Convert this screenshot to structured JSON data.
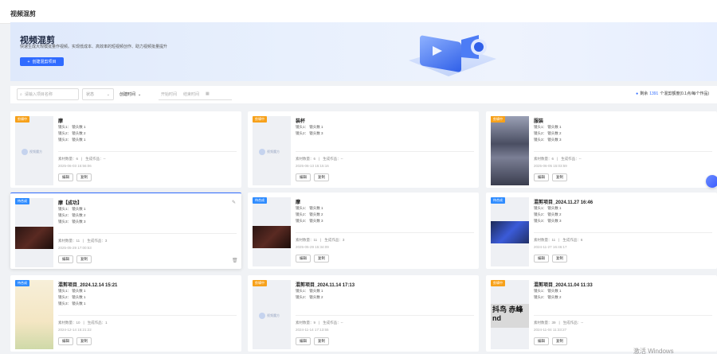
{
  "page": {
    "title": "视频混剪"
  },
  "banner": {
    "title": "视频混剪",
    "subtitle": "快速生成大规模批量作视频。实现低成本、高效率的短视频创作、助力视频批量提升",
    "create_button": "创建混剪项目"
  },
  "filters": {
    "search_placeholder": "请输入项目名称",
    "status_placeholder": "状态",
    "sort_label": "创建时间",
    "start_placeholder": "开始时间",
    "end_placeholder": "结束时间",
    "quota_prefix": "剩余",
    "quota_value": "1391",
    "quota_suffix": "个混剪额度(0.1点/每个作品)"
  },
  "cards": [
    {
      "badge": "剪辑中",
      "badge_color": "orange",
      "title": "摩",
      "lines": [
        "镜头1：  镜头数 1",
        "镜头2：  镜头数 2",
        "镜头3：  镜头数 1"
      ],
      "materials": "素材数量：6",
      "works": "生成作品：--",
      "date": "2025-06-03 15:56:06",
      "edit": "编辑",
      "copy": "复制",
      "thumb": "placeholder"
    },
    {
      "badge": "剪辑中",
      "badge_color": "orange",
      "title": "装杯",
      "lines": [
        "镜头1：  镜头数 1",
        "镜头2：  镜头数 3"
      ],
      "materials": "素材数量：6",
      "works": "生成作品：--",
      "date": "2025-06-13 15:15:16",
      "edit": "编辑",
      "copy": "复制",
      "thumb": "placeholder"
    },
    {
      "badge": "剪辑中",
      "badge_color": "orange",
      "title": "服装",
      "lines": [
        "镜头1：  镜头数 1",
        "镜头2：  镜头数 2",
        "镜头3：  镜头数 3"
      ],
      "materials": "素材数量：6",
      "works": "生成作品：--",
      "date": "2025-06-05 15:03:59",
      "edit": "编辑",
      "copy": "复制",
      "thumb": "store"
    },
    {
      "badge": "待合成",
      "badge_color": "blue",
      "title": "摩【成功】",
      "lines": [
        "镜头1：  镜头数 1",
        "镜头2：  镜头数 2",
        "镜头3：  镜头数 3"
      ],
      "materials": "素材数量：11",
      "works": "生成作品：3",
      "date": "2025-05-29 17:00:53",
      "edit": "编辑",
      "copy": "复制",
      "thumb": "dark",
      "active": true
    },
    {
      "badge": "待合成",
      "badge_color": "blue",
      "title": "摩",
      "lines": [
        "镜头1：  镜头数 1",
        "镜头2：  镜头数 2",
        "镜头3：  镜头数 3"
      ],
      "materials": "素材数量：11",
      "works": "生成作品：3",
      "date": "2025-05-29 15:34:09",
      "edit": "编辑",
      "copy": "复制",
      "thumb": "dark"
    },
    {
      "badge": "待合成",
      "badge_color": "blue",
      "title": "混剪项目_2024.11.27 16:46",
      "lines": [
        "镜头1：  镜头数 1",
        "镜头2：  镜头数 2",
        "镜头3：  镜头数 3"
      ],
      "materials": "素材数量：11",
      "works": "生成作品：6",
      "date": "2024-11-27 16:46:17",
      "edit": "编辑",
      "copy": "复制",
      "thumb": "laptop"
    },
    {
      "badge": "待合成",
      "badge_color": "blue",
      "title": "混剪项目_2024.12.14 15:21",
      "lines": [
        "镜头1：  镜头数 1",
        "镜头2：  镜头数 1",
        "镜头3：  镜头数 1"
      ],
      "materials": "素材数量：10",
      "works": "生成作品：1",
      "date": "2024-12-14 15:21:22",
      "edit": "编辑",
      "copy": "复制",
      "thumb": "paper"
    },
    {
      "badge": "剪辑中",
      "badge_color": "orange",
      "title": "混剪项目_2024.11.14 17:13",
      "lines": [
        "镜头1：  镜头数 1",
        "镜头2：  镜头数 2"
      ],
      "materials": "素材数量：9",
      "works": "生成作品：--",
      "date": "2024-11-14 17:13:55",
      "edit": "编辑",
      "copy": "复制",
      "thumb": "placeholder"
    },
    {
      "badge": "剪辑中",
      "badge_color": "orange",
      "title": "混剪项目_2024.11.04 11:33",
      "lines": [
        "镜头1：  镜头数 1",
        "镜头2：  镜头数 2"
      ],
      "materials": "素材数量：39",
      "works": "生成作品：--",
      "date": "2024-11-04 11:33:27",
      "edit": "编辑",
      "copy": "复制",
      "thumb": "text",
      "thumb_text": "抖鸟 赤峰 nd"
    }
  ],
  "placeholder_logo_text": "视频魔方",
  "watermark": "激活 Windows"
}
